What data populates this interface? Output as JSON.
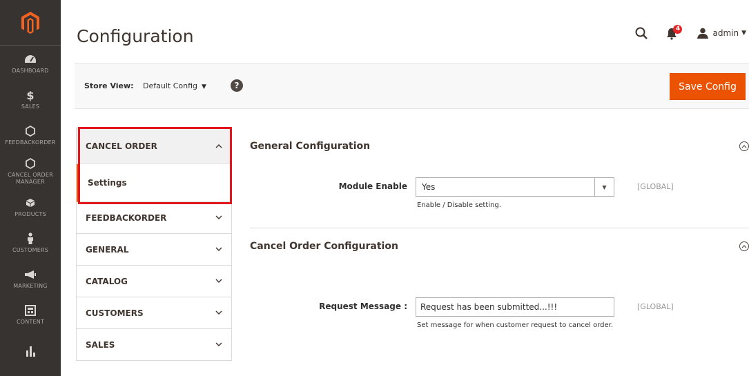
{
  "menu": {
    "items": [
      {
        "label": "DASHBOARD",
        "icon": "dashboard-icon"
      },
      {
        "label": "SALES",
        "icon": "dollar-icon"
      },
      {
        "label": "FEEDBACKORDER",
        "icon": "hexagon-icon"
      },
      {
        "label": "CANCEL ORDER MANAGER",
        "icon": "hexagon-icon"
      },
      {
        "label": "PRODUCTS",
        "icon": "box-icon"
      },
      {
        "label": "CUSTOMERS",
        "icon": "person-icon"
      },
      {
        "label": "MARKETING",
        "icon": "megaphone-icon"
      },
      {
        "label": "CONTENT",
        "icon": "layout-icon"
      },
      {
        "label": "",
        "icon": "bar-chart-icon"
      }
    ]
  },
  "header": {
    "title": "Configuration",
    "notification_count": "4",
    "user_name": "admin"
  },
  "store_bar": {
    "label": "Store View:",
    "value": "Default Config",
    "save_label": "Save Config"
  },
  "tabs": {
    "active": {
      "title": "CANCEL ORDER",
      "sub_item": "Settings"
    },
    "items": [
      {
        "title": "FEEDBACKORDER"
      },
      {
        "title": "GENERAL"
      },
      {
        "title": "CATALOG"
      },
      {
        "title": "CUSTOMERS"
      },
      {
        "title": "SALES"
      }
    ]
  },
  "sections": {
    "general": {
      "title": "General Configuration",
      "field_label": "Module Enable",
      "field_value": "Yes",
      "hint": "Enable / Disable setting.",
      "scope": "[GLOBAL]"
    },
    "cancel": {
      "title": "Cancel Order Configuration",
      "field_label": "Request Message :",
      "field_value": "Request has been submitted...!!!",
      "hint": "Set message for when customer request to cancel order.",
      "scope": "[GLOBAL]"
    }
  },
  "colors": {
    "accent": "#eb5202",
    "highlight": "#e3161d",
    "sidebar": "#373330"
  }
}
